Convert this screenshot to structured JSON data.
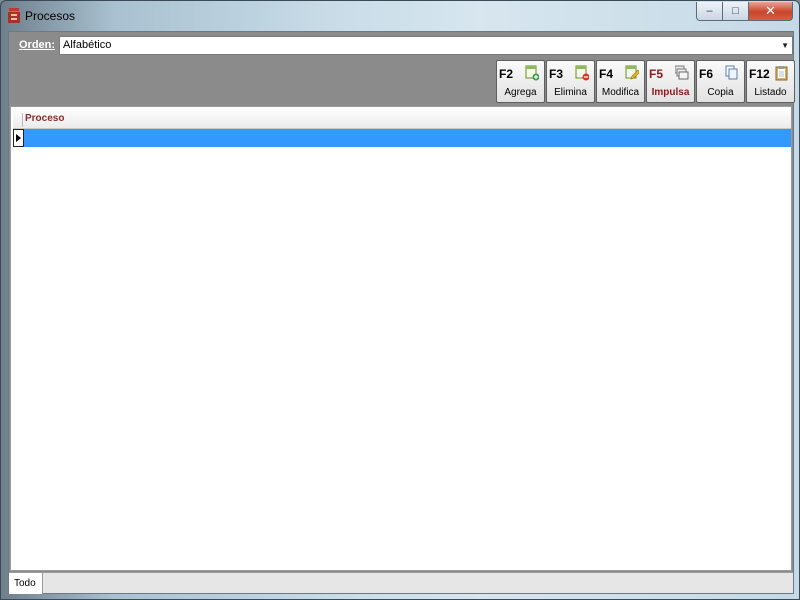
{
  "window": {
    "title": "Procesos",
    "controls": {
      "minimize": "–",
      "maximize": "□",
      "close": "✕"
    }
  },
  "order": {
    "label": "Orden:",
    "selected": "Alfabético"
  },
  "toolbar": {
    "buttons": [
      {
        "key": "F2",
        "label": "Agrega",
        "icon": "add-record-icon"
      },
      {
        "key": "F3",
        "label": "Elimina",
        "icon": "delete-record-icon"
      },
      {
        "key": "F4",
        "label": "Modifica",
        "icon": "edit-record-icon"
      },
      {
        "key": "F5",
        "label": "Impulsa",
        "icon": "impulse-records-icon",
        "active": true
      },
      {
        "key": "F6",
        "label": "Copia",
        "icon": "copy-icon"
      },
      {
        "key": "F12",
        "label": "Listado",
        "icon": "clipboard-list-icon"
      }
    ]
  },
  "grid": {
    "columns": [
      "Proceso"
    ],
    "rows": [
      ""
    ]
  },
  "statusbar": {
    "tab": "Todo"
  },
  "colors": {
    "selection": "#3399ff",
    "active_button": "#8b1a1a",
    "panel_gray": "#8b8b8b"
  }
}
